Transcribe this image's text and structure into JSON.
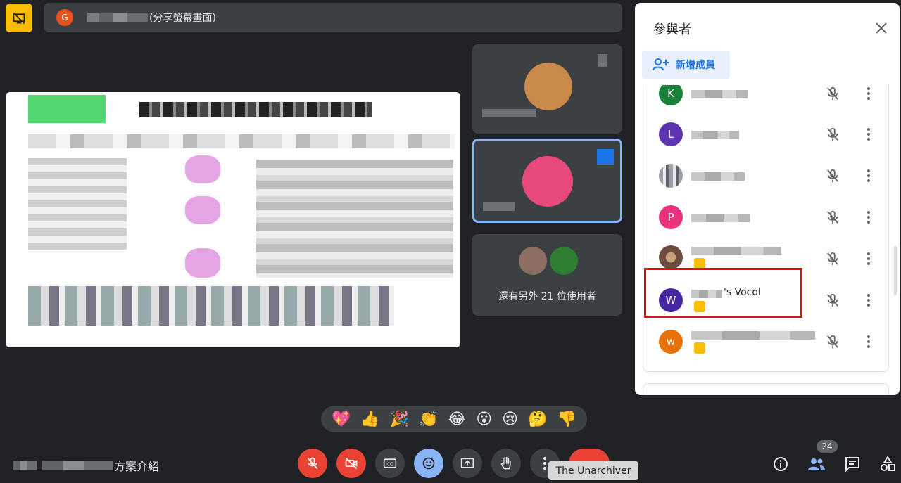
{
  "presenter": {
    "avatar_letter": "G",
    "label": "(分享螢幕畫面)",
    "avatar_color": "#e8501e"
  },
  "tiles": {
    "more_users": "還有另外 21 位使用者"
  },
  "participants_panel": {
    "title": "參與者",
    "add_member": "新增成員",
    "highlighted_name_suffix": "'s Vocol",
    "rows": [
      {
        "letter": "K",
        "color": "#188038"
      },
      {
        "letter": "L",
        "color": "#5e35b1"
      },
      {
        "letter": "",
        "color": "#9aa0a6"
      },
      {
        "letter": "P",
        "color": "#e8327c"
      },
      {
        "letter": "",
        "color": "#6d4c41"
      },
      {
        "letter": "W",
        "color": "#4527a0"
      },
      {
        "letter": "w",
        "color": "#e8710a"
      }
    ]
  },
  "reactions": [
    "💖",
    "👍",
    "🎉",
    "👏",
    "😂",
    "😮",
    "😢",
    "🤔",
    "👎"
  ],
  "bottom_bar": {
    "meeting_title_suffix": "方案介紹",
    "participant_count": "24",
    "tooltip": "The Unarchiver"
  },
  "colors": {
    "background": "#202124",
    "surface": "#3c4043",
    "accent_blue": "#8ab4f8",
    "danger_red": "#ea4335",
    "presenting_yellow": "#fbbc04",
    "highlight_red": "#e01010"
  }
}
